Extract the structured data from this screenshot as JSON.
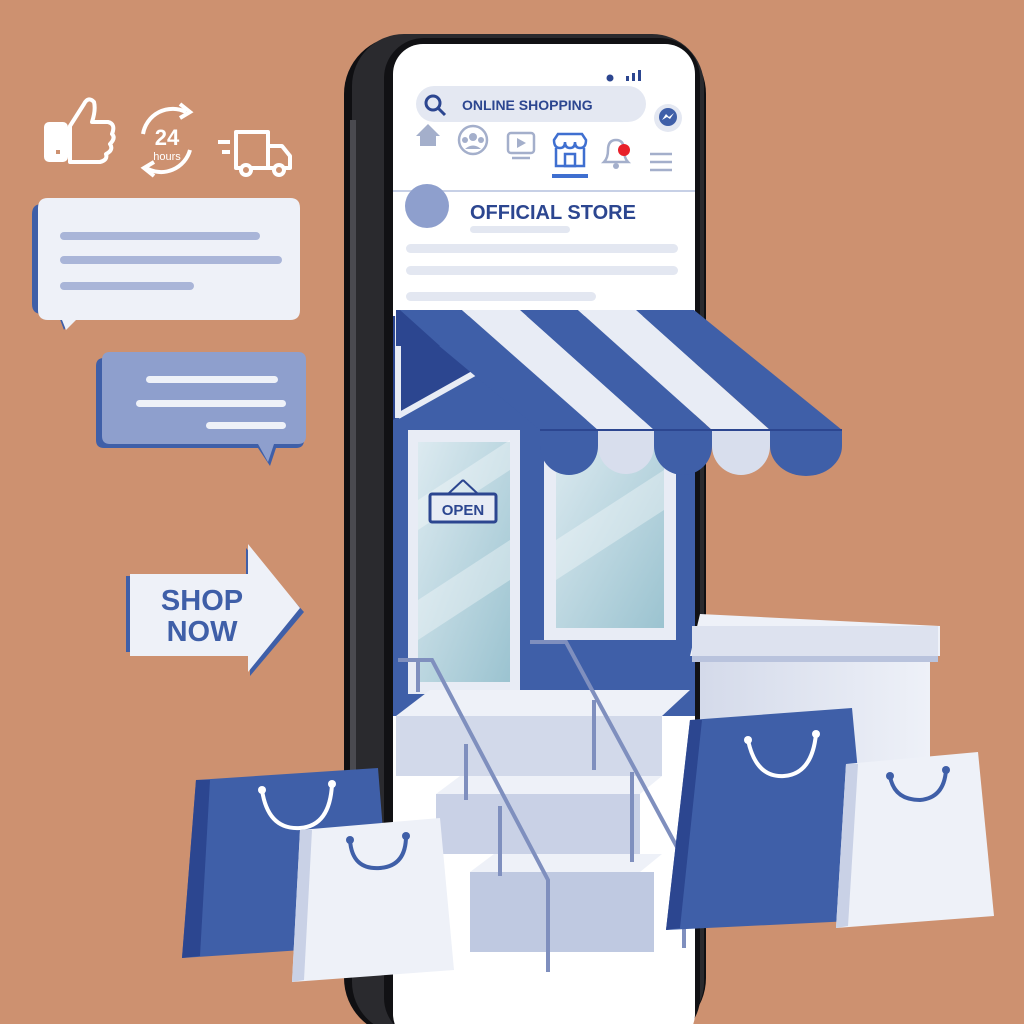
{
  "colors": {
    "background": "#CD9170",
    "brand_blue": "#3F5FA8",
    "dark_blue": "#2C4690",
    "light_panel": "#E8ECF5",
    "phone_frame": "#1A1A1D",
    "notification": "#E8202A"
  },
  "phone": {
    "search": {
      "placeholder": "ONLINE SHOPPING",
      "icon": "search-icon"
    },
    "messenger_icon": "messenger-icon",
    "nav_tabs": [
      {
        "icon": "home-icon",
        "active": false
      },
      {
        "icon": "groups-icon",
        "active": false
      },
      {
        "icon": "video-icon",
        "active": false
      },
      {
        "icon": "store-icon",
        "active": true
      },
      {
        "icon": "bell-icon",
        "active": false,
        "has_notification": true
      },
      {
        "icon": "menu-icon",
        "active": false
      }
    ],
    "post": {
      "title": "OFFICIAL STORE"
    }
  },
  "storefront": {
    "sign": "OPEN"
  },
  "badges": {
    "hours_number": "24",
    "hours_label": "hours",
    "icons": [
      "thumbs-up-icon",
      "24-hours-icon",
      "delivery-truck-icon"
    ]
  },
  "cta": {
    "line1": "SHOP",
    "line2": "NOW"
  }
}
